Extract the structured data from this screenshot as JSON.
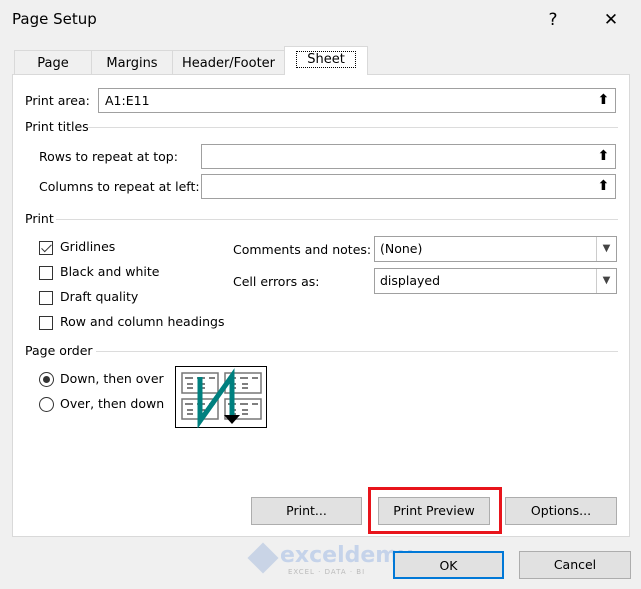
{
  "window": {
    "title": "Page Setup",
    "help_label": "?",
    "close_label": "✕"
  },
  "tabs": [
    {
      "label": "Page"
    },
    {
      "label": "Margins"
    },
    {
      "label": "Header/Footer"
    },
    {
      "label": "Sheet",
      "active": true
    }
  ],
  "print_area": {
    "label": "Print area:",
    "value": "A1:E11"
  },
  "print_titles": {
    "heading": "Print titles",
    "rows_label": "Rows to repeat at top:",
    "rows_value": "",
    "cols_label": "Columns to repeat at left:",
    "cols_value": ""
  },
  "print": {
    "heading": "Print",
    "checkboxes": [
      {
        "label": "Gridlines",
        "checked": true
      },
      {
        "label": "Black and white",
        "checked": false
      },
      {
        "label": "Draft quality",
        "checked": false
      },
      {
        "label": "Row and column headings",
        "checked": false
      }
    ],
    "comments_label": "Comments and notes:",
    "comments_value": "(None)",
    "errors_label": "Cell errors as:",
    "errors_value": "displayed"
  },
  "page_order": {
    "heading": "Page order",
    "options": [
      {
        "label": "Down, then over",
        "selected": true
      },
      {
        "label": "Over, then down",
        "selected": false
      }
    ]
  },
  "buttons": {
    "print": "Print...",
    "preview": "Print Preview",
    "options": "Options...",
    "ok": "OK",
    "cancel": "Cancel"
  },
  "watermark": {
    "name": "exceldemy",
    "tagline": "EXCEL · DATA · BI"
  },
  "colors": {
    "highlight": "#e8141b",
    "ok_border": "#0078d7",
    "arrow": "#00807f"
  }
}
